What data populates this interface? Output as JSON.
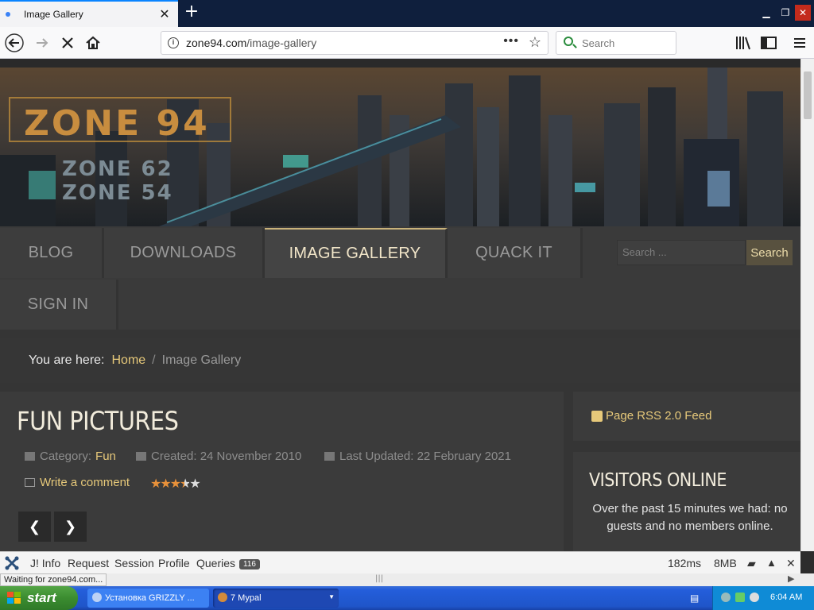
{
  "browser": {
    "tab_title": "Image Gallery",
    "url_host": "zone94.com",
    "url_path": "/image-gallery",
    "search_placeholder": "Search"
  },
  "banner": {
    "logo_main": "ZONE 94",
    "logo_sub1": "ZONE 62",
    "logo_sub2": "ZONE 54"
  },
  "nav": {
    "items": [
      {
        "label": "BLOG"
      },
      {
        "label": "DOWNLOADS"
      },
      {
        "label": "IMAGE GALLERY"
      },
      {
        "label": "QUACK IT"
      },
      {
        "label": "SIGN IN"
      }
    ],
    "search_placeholder": "Search ...",
    "search_button": "Search"
  },
  "breadcrumb": {
    "prefix": "You are here:",
    "home": "Home",
    "separator": "/",
    "current": "Image Gallery"
  },
  "article": {
    "title": "FUN PICTURES",
    "category_label": "Category:",
    "category": "Fun",
    "created": "Created: 24 November 2010",
    "updated": "Last Updated: 22 February 2021",
    "comment_link": "Write a comment",
    "rating": 3.5,
    "rating_max": 5
  },
  "sidebar": {
    "rss_link": "Page RSS 2.0 Feed",
    "visitors_title": "VISITORS ONLINE",
    "visitors_text": "Over the past 15 minutes we had: no guests and no members online."
  },
  "debugbar": {
    "info": "J! Info",
    "request": "Request",
    "session": "Session",
    "profile": "Profile",
    "queries": "Queries",
    "queries_count": "116",
    "time": "182ms",
    "memory": "8MB"
  },
  "status_text": "Waiting for zone94.com...",
  "taskbar": {
    "start": "start",
    "task1": "Установка GRIZZLY ...",
    "task2": "7 Mypal",
    "clock": "6:04 AM"
  },
  "colors": {
    "accent_gold": "#e7c97a",
    "page_bg": "#353535",
    "taskbar_blue": "#245edb"
  }
}
